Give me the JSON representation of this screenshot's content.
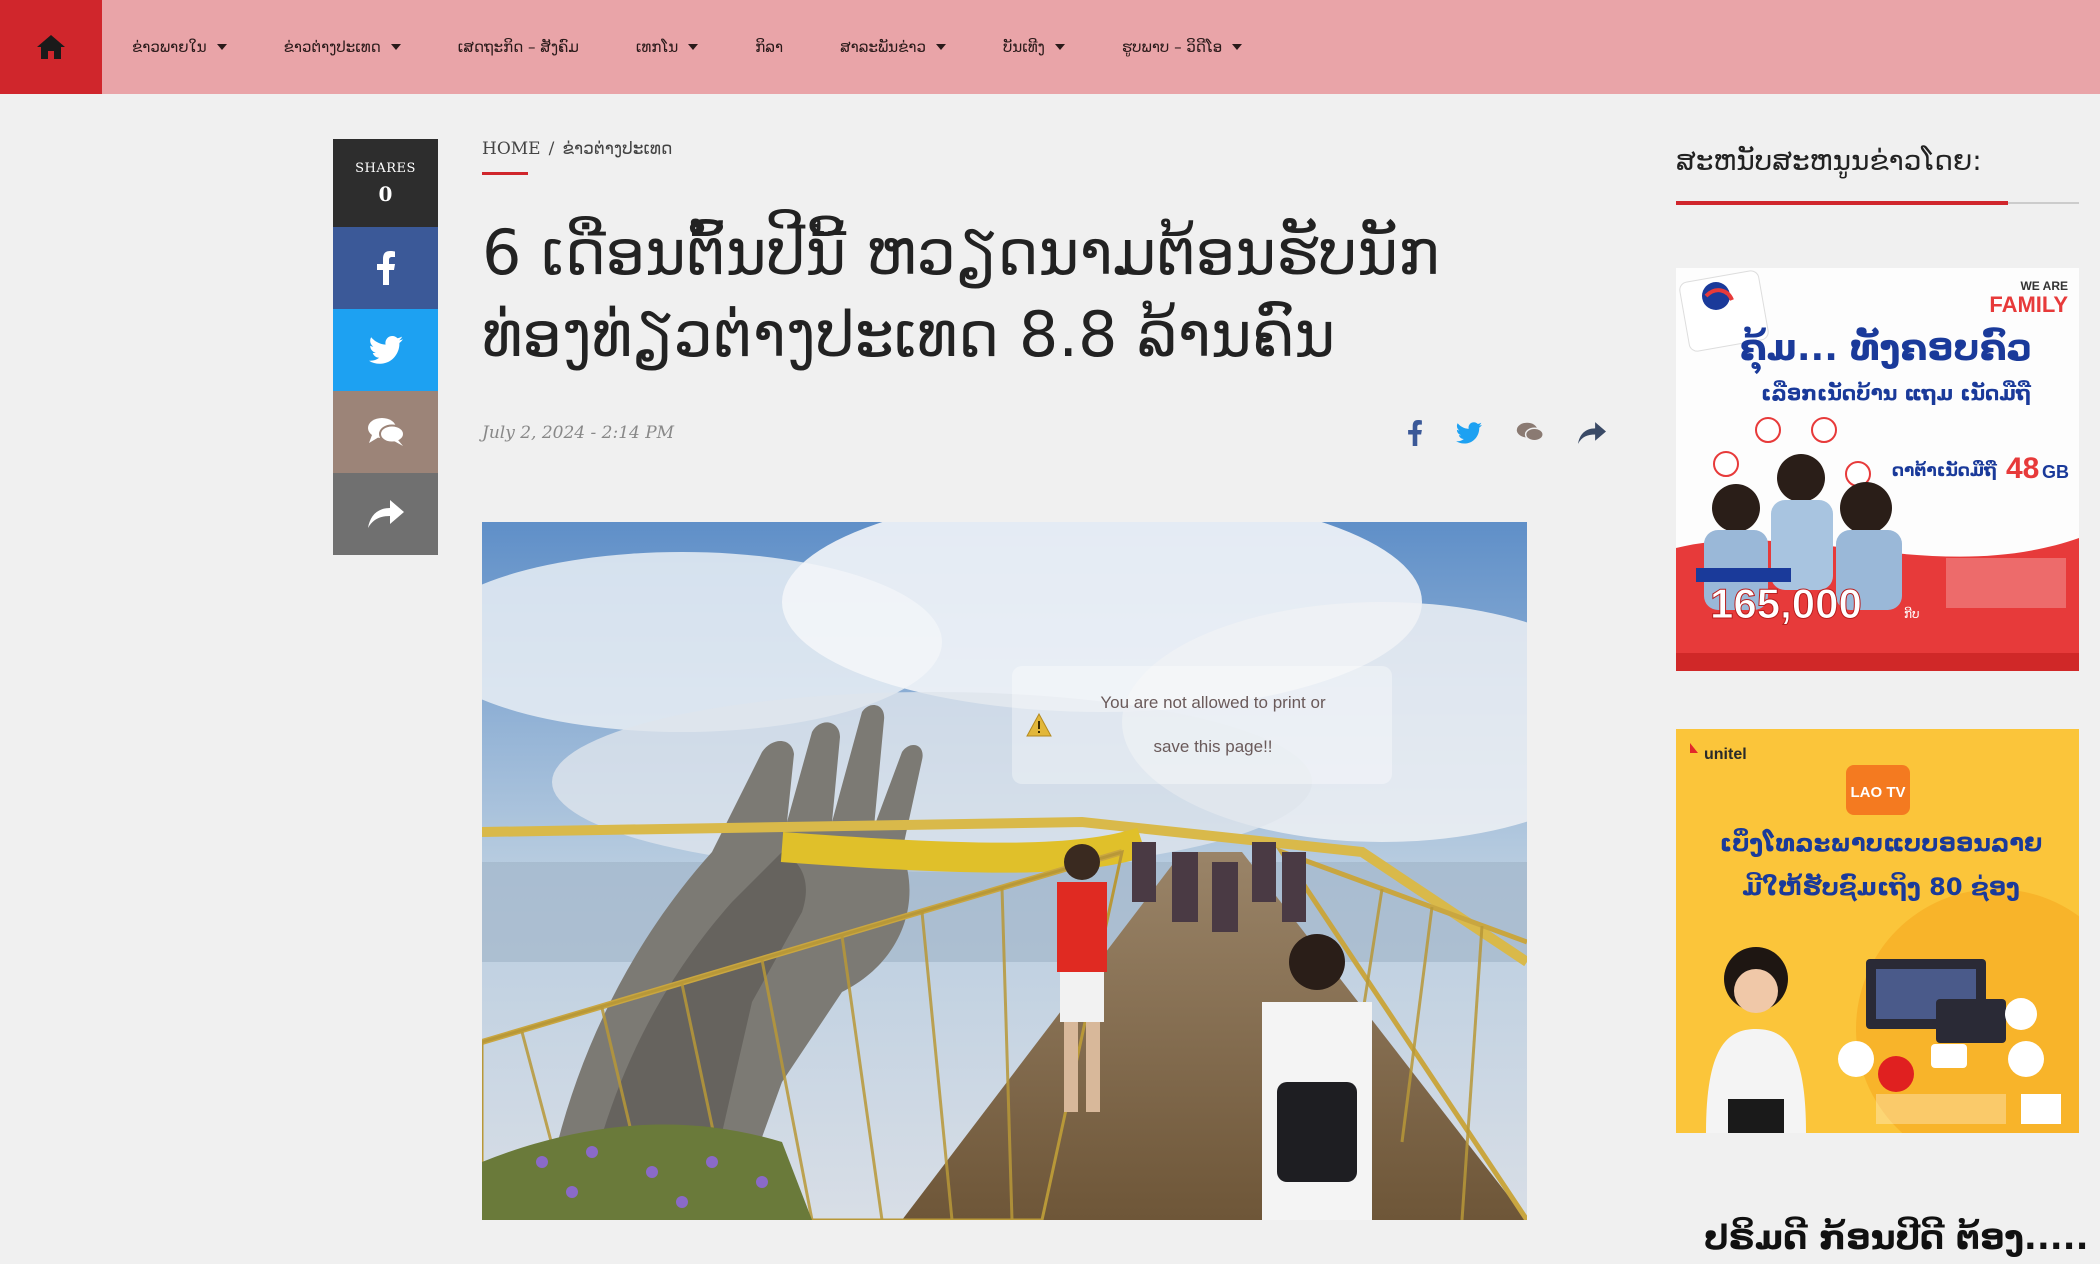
{
  "nav": {
    "items": [
      {
        "label": "ຂ່າວພາຍໃນ",
        "has_caret": true
      },
      {
        "label": "ຂ່າວຕ່າງປະເທດ",
        "has_caret": true
      },
      {
        "label": "ເສດຖະກິດ – ສັງຄົມ",
        "has_caret": false
      },
      {
        "label": "ເທກໂນ",
        "has_caret": true
      },
      {
        "label": "ກິລາ",
        "has_caret": false
      },
      {
        "label": "ສາລະພັນຂ່າວ",
        "has_caret": true
      },
      {
        "label": "ບັນເທີງ",
        "has_caret": true
      },
      {
        "label": "ຮູບພາບ – ວິດີໂອ",
        "has_caret": true
      }
    ]
  },
  "share_bar": {
    "label": "SHARES",
    "count": "0"
  },
  "breadcrumb": {
    "home": "HOME",
    "separator": "/",
    "current": "ຂ່າວຕ່າງປະເທດ"
  },
  "article": {
    "title": "6 ເດືອນຕົ້ນປີນີ້ ຫວຽດນາມຕ້ອນຮັບນັກທ່ອງທ່ຽວຕ່າງປະເທດ 8.8 ລ້ານຄົນ",
    "date": "July 2, 2024 - 2:14 PM"
  },
  "print_warning": {
    "line1": "You are not allowed to print or",
    "line2": "save this page!!"
  },
  "sidebar": {
    "title": "ສະຫນັບສະຫນູນຂ່າວໂດຍ:",
    "ad1": {
      "tag_top": "WE ARE",
      "tag_family": "FAMILY",
      "headline": "ຄຸ້ມ... ທັງຄອບຄົວ",
      "sub": "ເລືອກເນັດບ້ານ ແຖມ ເນັດມືຖື",
      "data_label": "ດາຕ້າເນັດມືຖື",
      "data_value": "48",
      "data_unit": "GB",
      "price": "165,000",
      "price_unit": "ກີບ"
    },
    "ad2": {
      "brand": "unitel",
      "logo": "LAO TV",
      "headline": "ເບິ່ງໂທລະພາບແບບອອນລາຍ",
      "sub": "ມີໃຫ້ຮັບຊົມເຖິງ 80 ຊ່ອງ"
    }
  },
  "bottom_teaser": "ປຣິມດີ ກ້ອນປີດີ ຕ້ອງ.....",
  "colors": {
    "nav_bg": "#e9a4a8",
    "accent": "#d0262c",
    "facebook": "#3b5998",
    "twitter": "#1da1f2"
  }
}
